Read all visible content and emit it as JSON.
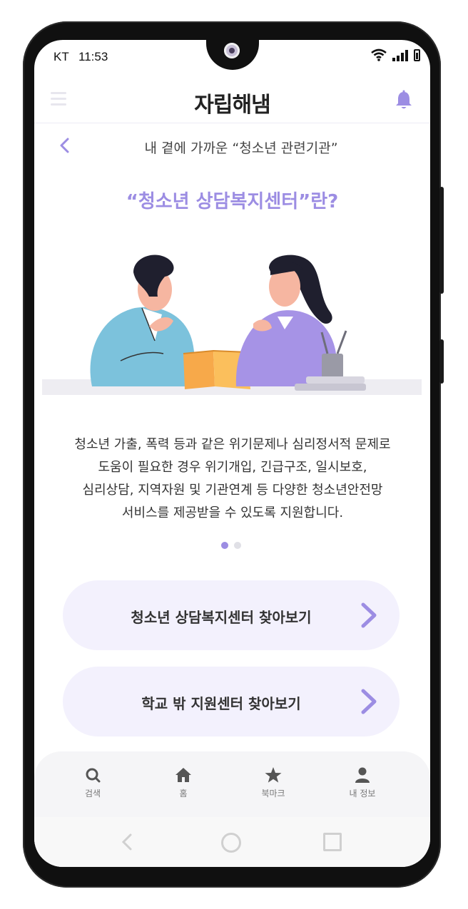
{
  "status": {
    "carrier": "KT",
    "time": "11:53"
  },
  "header": {
    "logo": "자립해냄",
    "menu_icon": "hamburger-icon",
    "bell_icon": "bell-icon"
  },
  "page": {
    "subtitle": "내 곁에 가까운 “청소년 관련기관”",
    "title": "“청소년 상담복지센터”란?",
    "description": [
      "청소년 가출, 폭력 등과 같은 위기문제나 심리정서적 문제로",
      "도움이 필요한 경우 위기개입, 긴급구조, 일시보호,",
      "심리상담, 지역자원 및 기관연계 등 다양한 청소년안전망",
      "서비스를 제공받을 수 있도록 지원합니다."
    ],
    "carousel": {
      "index": 1,
      "total": 2
    }
  },
  "actions": [
    {
      "label": "청소년 상담복지센터 찾아보기"
    },
    {
      "label": "학교 밖 지원센터 찾아보기"
    }
  ],
  "tabs": [
    {
      "label": "검색",
      "icon": "search-icon"
    },
    {
      "label": "홈",
      "icon": "home-icon"
    },
    {
      "label": "북마크",
      "icon": "star-icon"
    },
    {
      "label": "내 정보",
      "icon": "person-icon"
    }
  ],
  "colors": {
    "accent": "#9c8de3",
    "card_bg": "#f3f1fd"
  }
}
